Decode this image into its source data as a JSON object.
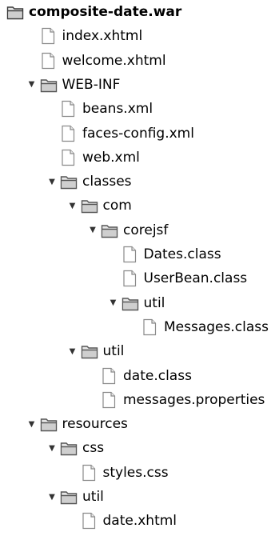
{
  "tree": {
    "nodes": [
      {
        "label": "composite-date.war",
        "icon": "archive-folder-icon",
        "expanded": true,
        "bold": true
      },
      {
        "label": "index.xhtml",
        "icon": "file-icon"
      },
      {
        "label": "welcome.xhtml",
        "icon": "file-icon"
      },
      {
        "label": "WEB-INF",
        "icon": "folder-open-icon",
        "expanded": true
      },
      {
        "label": "beans.xml",
        "icon": "file-icon"
      },
      {
        "label": "faces-config.xml",
        "icon": "file-icon"
      },
      {
        "label": "web.xml",
        "icon": "file-icon"
      },
      {
        "label": "classes",
        "icon": "folder-open-icon",
        "expanded": true
      },
      {
        "label": "com",
        "icon": "folder-open-icon",
        "expanded": true
      },
      {
        "label": "corejsf",
        "icon": "folder-open-icon",
        "expanded": true
      },
      {
        "label": "Dates.class",
        "icon": "file-icon"
      },
      {
        "label": "UserBean.class",
        "icon": "file-icon"
      },
      {
        "label": "util",
        "icon": "folder-open-icon",
        "expanded": true
      },
      {
        "label": "Messages.class",
        "icon": "file-icon"
      },
      {
        "label": "util",
        "icon": "folder-open-icon",
        "expanded": true
      },
      {
        "label": "date.class",
        "icon": "file-icon"
      },
      {
        "label": "messages.properties",
        "icon": "file-icon"
      },
      {
        "label": "resources",
        "icon": "folder-open-icon",
        "expanded": true
      },
      {
        "label": "css",
        "icon": "folder-open-icon",
        "expanded": true
      },
      {
        "label": "styles.css",
        "icon": "file-icon"
      },
      {
        "label": "util",
        "icon": "folder-open-icon",
        "expanded": true
      },
      {
        "label": "date.xhtml",
        "icon": "file-icon"
      }
    ]
  }
}
